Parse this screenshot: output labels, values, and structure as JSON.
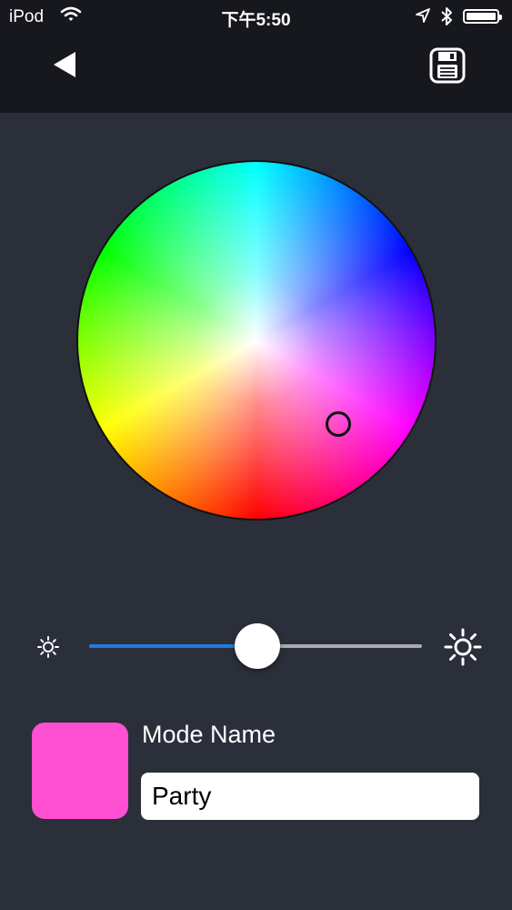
{
  "status_bar": {
    "carrier": "iPod",
    "time": "下午5:50"
  },
  "nav": {
    "back_icon": "back-triangle-icon",
    "save_icon": "floppy-disk-icon"
  },
  "color_wheel": {
    "selected_color": "#ff4fd2"
  },
  "brightness": {
    "value": 0.5,
    "low_icon": "sun-small-icon",
    "high_icon": "sun-large-icon",
    "fill_color": "#1f7be0"
  },
  "mode": {
    "label": "Mode Name",
    "value": "Party",
    "swatch_color": "#ff4fd2"
  }
}
